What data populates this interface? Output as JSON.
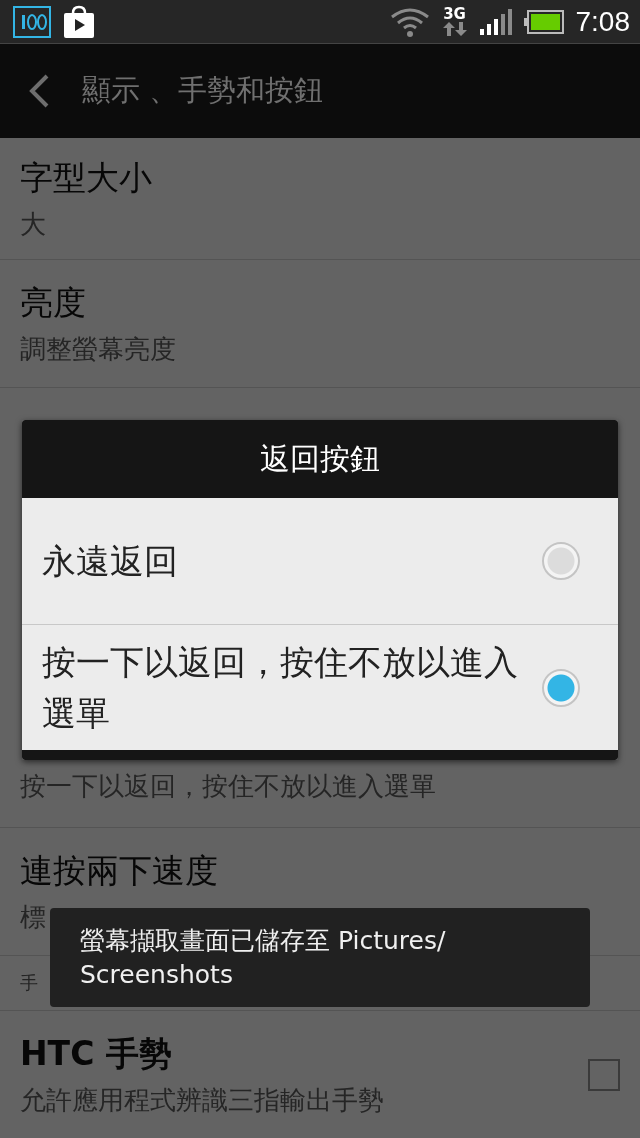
{
  "status_bar": {
    "time": "7:08",
    "network": "3G"
  },
  "action_bar": {
    "title": "顯示 、手勢和按鈕"
  },
  "settings": [
    {
      "kind": "setting",
      "title": "字型大小",
      "subtitle": "大"
    },
    {
      "kind": "setting",
      "title": "亮度",
      "subtitle": "調整螢幕亮度"
    },
    {
      "kind": "covered"
    },
    {
      "kind": "setting",
      "subtitle": "按一下以返回，按住不放以進入選單"
    },
    {
      "kind": "setting",
      "title": "連按兩下速度",
      "subtitle": "標"
    },
    {
      "kind": "header",
      "label": "手"
    },
    {
      "kind": "checkbox",
      "title": "HTC 手勢",
      "subtitle": "允許應用程式辨識三指輸出手勢",
      "checked": false
    }
  ],
  "dialog": {
    "title": "返回按鈕",
    "options": [
      {
        "label": "永遠返回",
        "selected": false
      },
      {
        "label": "按一下以返回，按住不放以進入選單",
        "selected": true
      }
    ]
  },
  "toast": {
    "text": "螢幕擷取畫面已儲存至 Pictures/ Screenshots"
  }
}
